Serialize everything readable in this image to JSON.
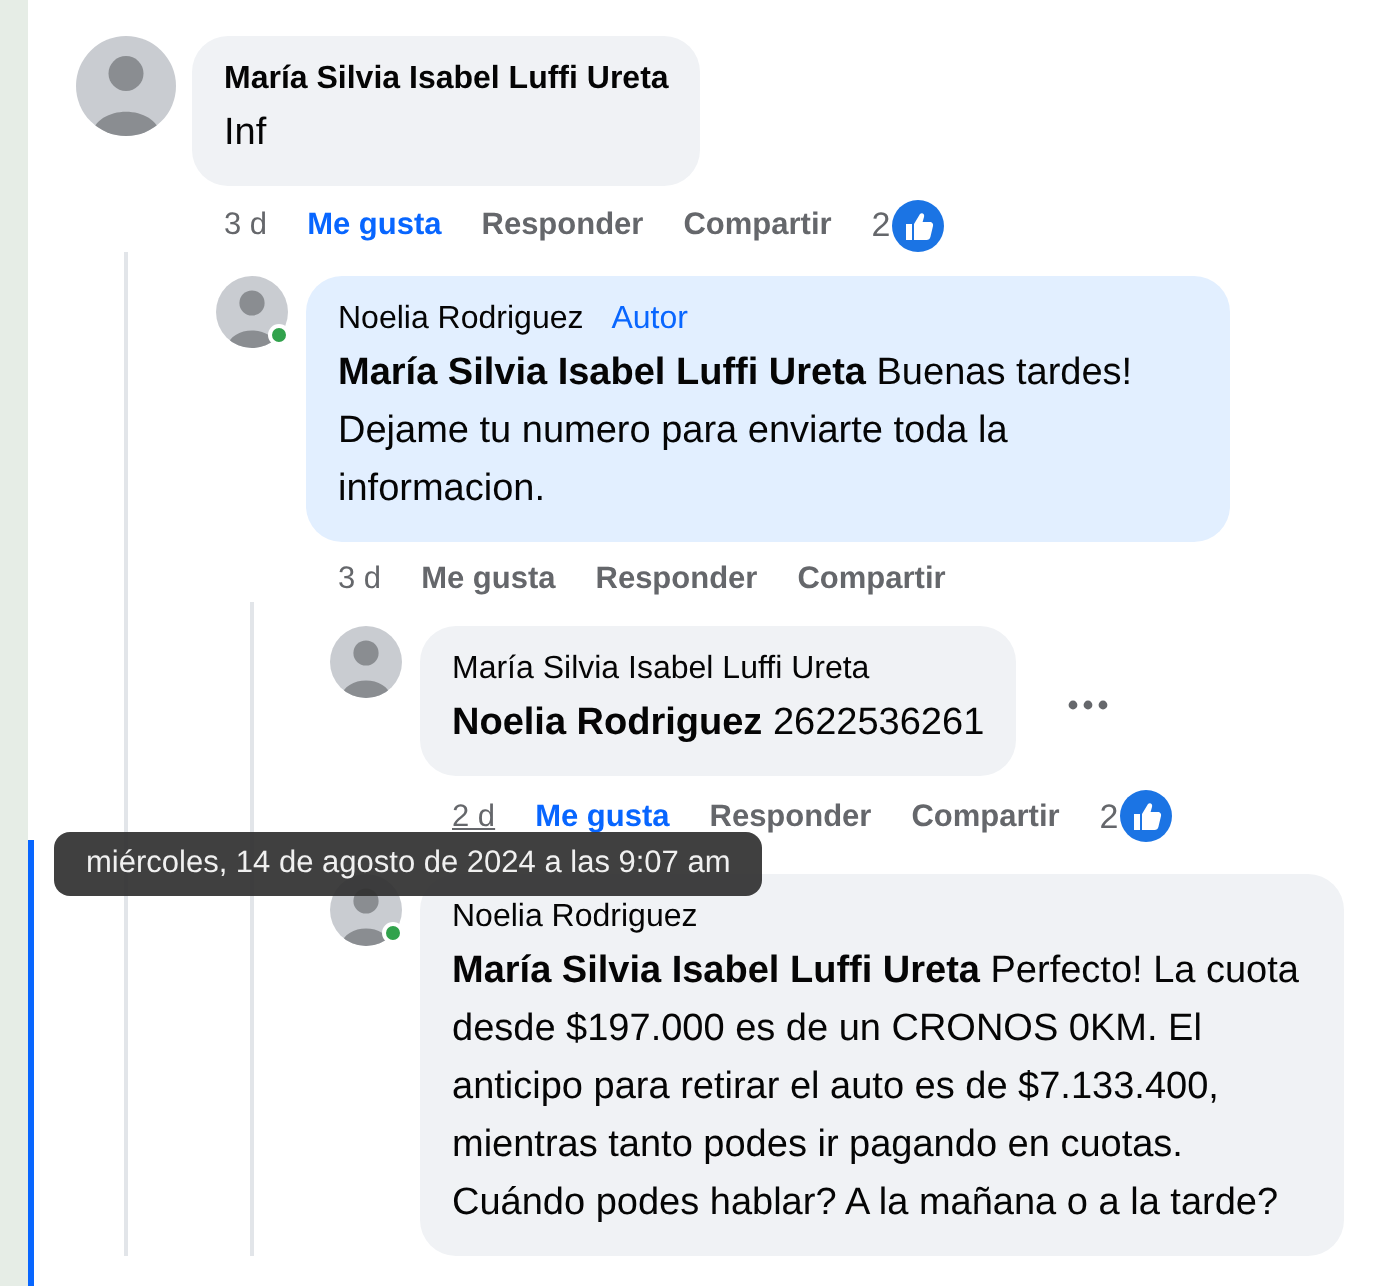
{
  "comments": [
    {
      "author": "María Silvia Isabel Luffi Ureta",
      "online": false,
      "highlighted": false,
      "text": "Inf",
      "time": "3 d",
      "time_hovered": false,
      "actions": [
        "Me gusta",
        "Responder",
        "Compartir"
      ],
      "liked": true,
      "like_count": "2",
      "more_menu": false,
      "children": [
        {
          "author": "Noelia Rodriguez",
          "author_badge": "Autor",
          "online": true,
          "highlighted": true,
          "text": "**María Silvia Isabel Luffi Ureta** Buenas tardes! Dejame tu numero para enviarte toda la informacion.",
          "time": "3 d",
          "time_hovered": false,
          "actions": [
            "Me gusta",
            "Responder",
            "Compartir"
          ],
          "liked": false,
          "more_menu": false,
          "children": [
            {
              "author": "María Silvia Isabel Luffi Ureta",
              "online": false,
              "highlighted": false,
              "text": "**Noelia Rodriguez** 2622536261",
              "time": "2 d",
              "time_hovered": true,
              "actions": [
                "Me gusta",
                "Responder",
                "Compartir"
              ],
              "liked": true,
              "like_count": "2",
              "more_menu": true
            },
            {
              "author": "Noelia Rodriguez",
              "online": true,
              "highlighted": false,
              "text": "**María Silvia Isabel Luffi Ureta** Perfecto! La cuota desde $197.000 es de un CRONOS 0KM. El anticipo para retirar el auto es de $7.133.400, mientras tanto podes ir pagando en cuotas. Cuándo podes hablar? A la mañana o a la tarde?",
              "more_menu": false
            }
          ]
        }
      ]
    }
  ],
  "tooltip": {
    "text": "miércoles, 14 de agosto de 2024 a las 9:07 am"
  }
}
